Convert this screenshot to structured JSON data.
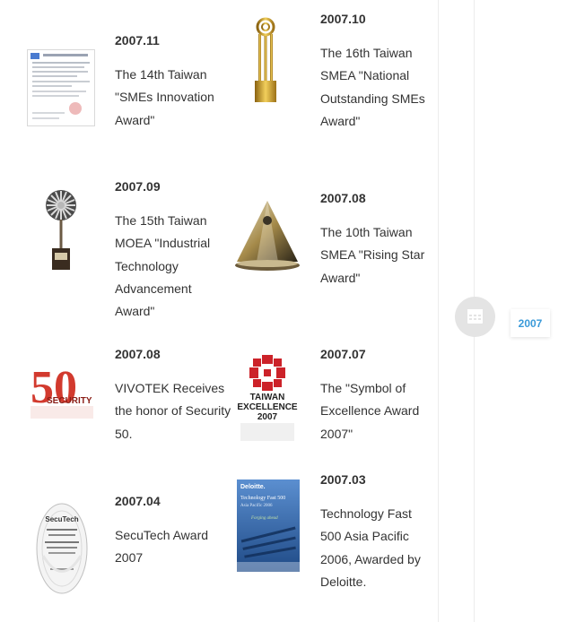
{
  "awards": [
    {
      "date": "2007.11",
      "text": "The 14th Taiwan \"SMEs Innovation Award\""
    },
    {
      "date": "2007.10",
      "text": "The 16th Taiwan SMEA \"National Outstanding SMEs Award\""
    },
    {
      "date": "2007.09",
      "text": "The 15th Taiwan MOEA \"Industrial Technology Advancement Award\""
    },
    {
      "date": "2007.08",
      "text": "The 10th Taiwan SMEA \"Rising Star Award\""
    },
    {
      "date": "2007.08",
      "text": "VIVOTEK Receives the honor of Security 50."
    },
    {
      "date": "2007.07",
      "text": "The \"Symbol of Excellence Award 2007\""
    },
    {
      "date": "2007.04",
      "text": "SecuTech Award 2007"
    },
    {
      "date": "2007.03",
      "text": "Technology Fast 500 Asia Pacific 2006, Awarded by Deloitte."
    }
  ],
  "timeline": {
    "year": "2007",
    "icon": "calendar-icon"
  },
  "thumbnails": {
    "security50_number": "50",
    "security50_word": "SECURITY",
    "taiwan_excellence_line1": "TAIWAN",
    "taiwan_excellence_line2": "EXCELLENCE",
    "taiwan_excellence_year": "2007",
    "deloitte_brand": "Deloitte.",
    "deloitte_title": "Technology Fast 500",
    "deloitte_subtitle": "Asia Pacific  2006",
    "deloitte_tagline": "Forging ahead",
    "secutech_brand": "SecuTech"
  },
  "colors": {
    "accent": "#3a9ad9",
    "text": "#333333",
    "dot": "#e4e4e4",
    "security_red": "#d23a2e",
    "excellence_red": "#cc2229",
    "deloitte_blue": "#2f63a6"
  }
}
